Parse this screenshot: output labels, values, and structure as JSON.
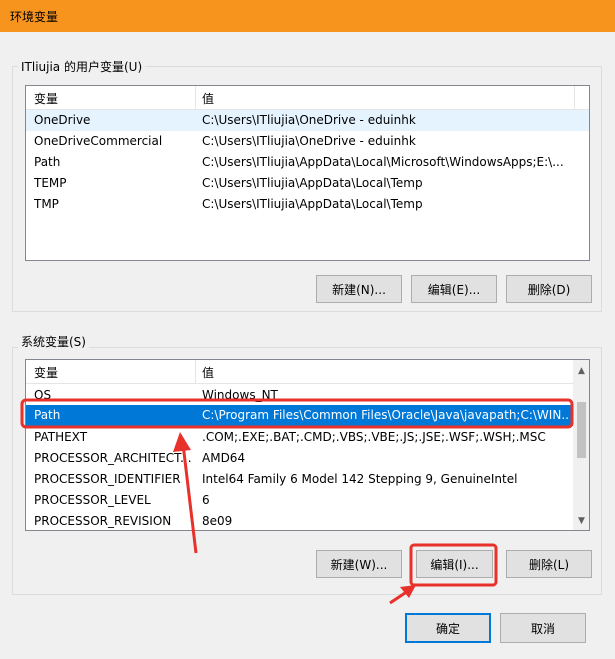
{
  "window": {
    "title": "环境变量"
  },
  "user_vars": {
    "group_title": "ITliujia 的用户变量(U)",
    "columns": [
      "变量",
      "值"
    ],
    "rows": [
      {
        "name": "OneDrive",
        "value": "C:\\Users\\ITliujia\\OneDrive - eduinhk"
      },
      {
        "name": "OneDriveCommercial",
        "value": "C:\\Users\\ITliujia\\OneDrive - eduinhk"
      },
      {
        "name": "Path",
        "value": "C:\\Users\\ITliujia\\AppData\\Local\\Microsoft\\WindowsApps;E:\\..."
      },
      {
        "name": "TEMP",
        "value": "C:\\Users\\ITliujia\\AppData\\Local\\Temp"
      },
      {
        "name": "TMP",
        "value": "C:\\Users\\ITliujia\\AppData\\Local\\Temp"
      }
    ],
    "buttons": {
      "new": "新建(N)...",
      "edit": "编辑(E)...",
      "delete": "删除(D)"
    }
  },
  "system_vars": {
    "group_title": "系统变量(S)",
    "columns": [
      "变量",
      "值"
    ],
    "rows": [
      {
        "name": "OS",
        "value": "Windows_NT"
      },
      {
        "name": "Path",
        "value": "C:\\Program Files\\Common Files\\Oracle\\Java\\javapath;C:\\WIN..."
      },
      {
        "name": "PATHEXT",
        "value": ".COM;.EXE;.BAT;.CMD;.VBS;.VBE;.JS;.JSE;.WSF;.WSH;.MSC"
      },
      {
        "name": "PROCESSOR_ARCHITECT...",
        "value": "AMD64"
      },
      {
        "name": "PROCESSOR_IDENTIFIER",
        "value": "Intel64 Family 6 Model 142 Stepping 9, GenuineIntel"
      },
      {
        "name": "PROCESSOR_LEVEL",
        "value": "6"
      },
      {
        "name": "PROCESSOR_REVISION",
        "value": "8e09"
      }
    ],
    "buttons": {
      "new": "新建(W)...",
      "edit": "编辑(I)...",
      "delete": "删除(L)"
    }
  },
  "dialog_buttons": {
    "ok": "确定",
    "cancel": "取消"
  },
  "colors": {
    "titlebar": "#f7941d",
    "selection": "#0078d7",
    "hover_row": "#e5f3ff",
    "annotation": "#e8312a"
  }
}
